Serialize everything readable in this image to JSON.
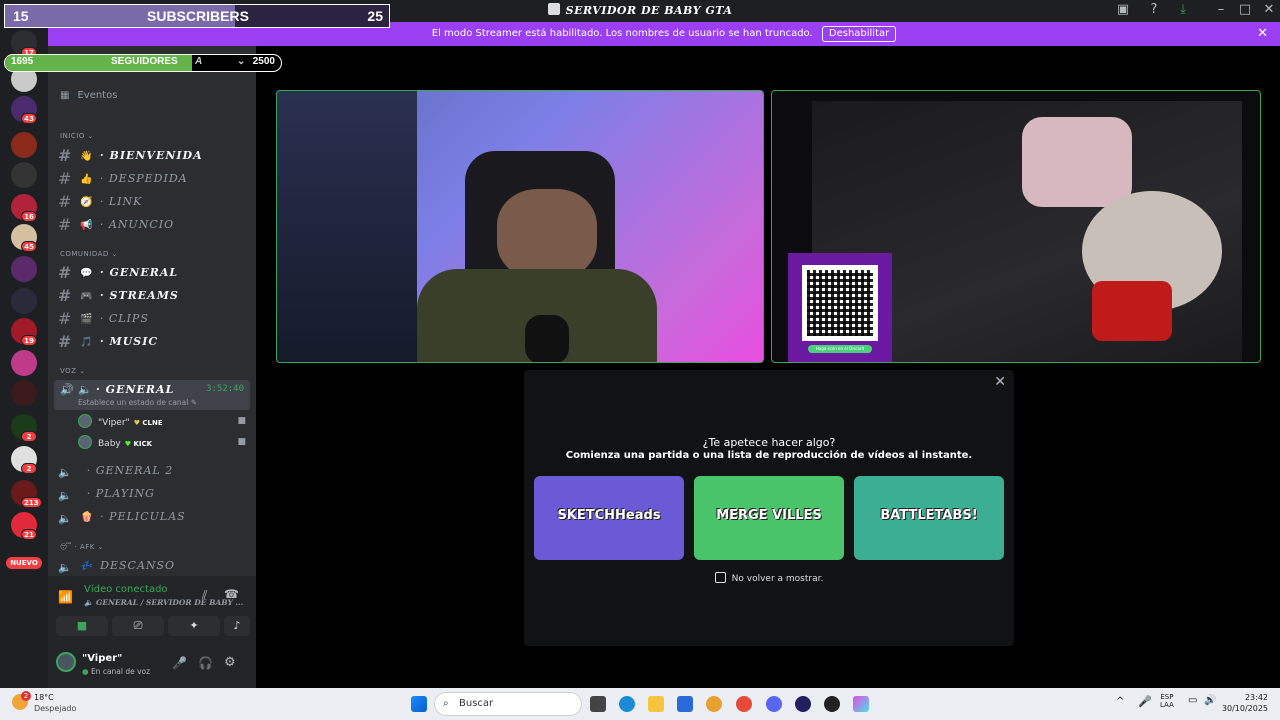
{
  "window": {
    "title": "SERVIDOR DE BABY GTA"
  },
  "overlays": {
    "subscribers": {
      "current": "15",
      "label": "SUBSCRIBERS",
      "goal": "25",
      "progress": 0.6
    },
    "followers": {
      "current": "1695",
      "label": "SEGUIDORES",
      "goal": "2500",
      "progress": 0.678,
      "server_name_fragment": "A"
    }
  },
  "streamer_bar": {
    "text": "El modo Streamer está habilitado. Los nombres de usuario se han truncado.",
    "button": "Deshabilitar"
  },
  "servers": [
    {
      "badge": "17",
      "color": "#2b2d31"
    },
    {
      "badge": "",
      "color": "#c9c9c9"
    },
    {
      "badge": "43",
      "color": "#4a2b6e"
    },
    {
      "badge": "",
      "color": "#8a2a1a"
    },
    {
      "badge": "",
      "color": "#333333"
    },
    {
      "badge": "16",
      "color": "#b1233a"
    },
    {
      "badge": "45",
      "color": "#d4c0a0"
    },
    {
      "badge": "",
      "color": "#5a2a6a"
    },
    {
      "badge": "",
      "color": "#2a2a3a"
    },
    {
      "badge": "19",
      "color": "#a01a2a"
    },
    {
      "badge": "",
      "color": "#c03a8a"
    },
    {
      "badge": "",
      "color": "#3a1a1a"
    },
    {
      "badge": "2",
      "color": "#1a3a1a"
    },
    {
      "badge": "2",
      "color": "#e0e0e0"
    },
    {
      "badge": "213",
      "color": "#6a1a1a"
    },
    {
      "badge": "21",
      "color": "#e02a3a"
    }
  ],
  "nuevo_label": "NUEVO",
  "sidebar": {
    "events": "Eventos",
    "categories": {
      "inicio": "INICIO",
      "comunidad": "COMUNIDAD",
      "voz": "VOZ",
      "afk": "AFK"
    },
    "text_channels_inicio": [
      {
        "emoji": "👋",
        "name": "BIENVENIDA",
        "unread": true
      },
      {
        "emoji": "👍",
        "name": "DESPEDIDA",
        "unread": false
      },
      {
        "emoji": "🧭",
        "name": "LINK",
        "unread": false
      },
      {
        "emoji": "📢",
        "name": "ANUNCIO",
        "unread": false
      }
    ],
    "text_channels_comunidad": [
      {
        "emoji": "💬",
        "name": "GENERAL",
        "unread": true
      },
      {
        "emoji": "🎮",
        "name": "STREAMS",
        "unread": true
      },
      {
        "emoji": "🎬",
        "name": "CLIPS",
        "unread": false
      },
      {
        "emoji": "🎵",
        "name": "MUSIC",
        "unread": true
      }
    ],
    "active_voice": {
      "name": "GENERAL",
      "timer": "3:52:40",
      "status": "Establece un estado de canal"
    },
    "voice_users": [
      {
        "name": "\"Viper\"",
        "tag": "CLNE",
        "tag_color": "#e6c84a"
      },
      {
        "name": "Baby",
        "tag": "KICK",
        "tag_color": "#53fc18"
      }
    ],
    "voice_channels": [
      {
        "emoji": "",
        "name": "GENERAL 2"
      },
      {
        "emoji": "",
        "name": "PLAYING"
      },
      {
        "emoji": "🍿",
        "name": "PELICULAS"
      }
    ],
    "afk_channel": {
      "emoji": "💤",
      "name": "DESCANSO"
    }
  },
  "voice_panel": {
    "status": "Vídeo conectado",
    "location": "GENERAL / SERVIDOR DE BABY ...",
    "user": "\"Viper\"",
    "user_status": "En canal de voz"
  },
  "activity": {
    "title": "¿Te apetece hacer algo?",
    "subtitle": "Comienza una partida o una lista de reproducción de vídeos al instante.",
    "games": [
      {
        "name": "SKETCHHeads",
        "bg": "#6b5ad6"
      },
      {
        "name": "MERGE VILLES",
        "bg": "#49c46b"
      },
      {
        "name": "BATTLETABS!",
        "bg": "#3cae94"
      }
    ],
    "checkbox_label": "No volver a mostrar."
  },
  "qr_caption": "Haga scan en el Discord",
  "taskbar": {
    "weather_temp": "18°C",
    "weather_desc": "Despejado",
    "weather_badge": "2",
    "search": "Buscar",
    "lang": "ESP",
    "lang2": "LAA",
    "time": "23:42",
    "date": "30/10/2025"
  }
}
